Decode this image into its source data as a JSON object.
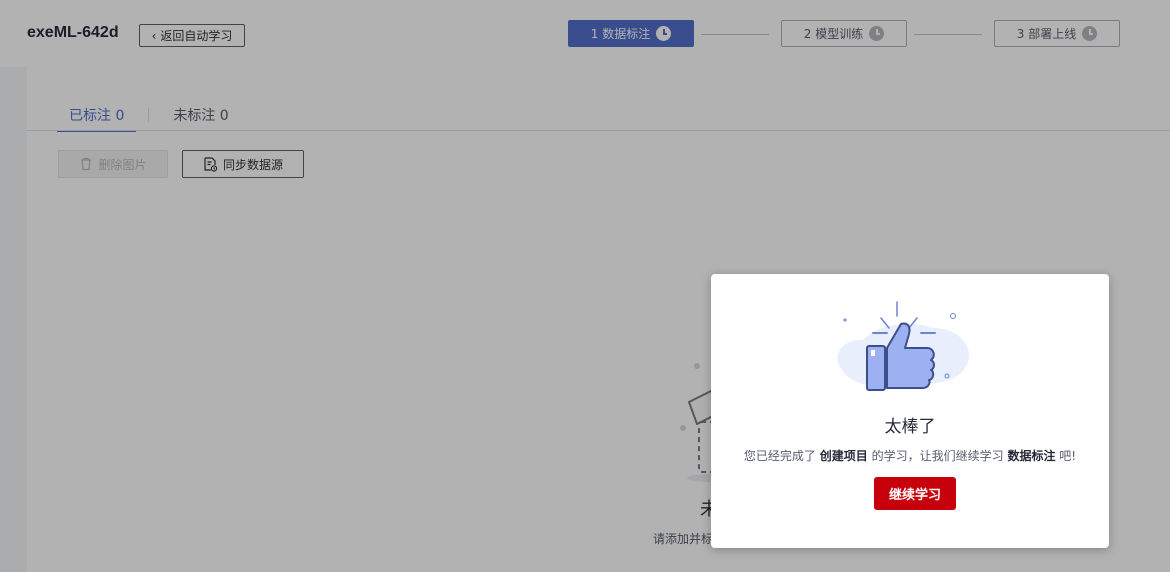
{
  "header": {
    "project_title": "exeML-642d",
    "back_label": "返回自动学习",
    "steps": [
      {
        "label": "1 数据标注",
        "state": "active"
      },
      {
        "label": "2 模型训练",
        "state": "pending"
      },
      {
        "label": "3 部署上线",
        "state": "pending"
      }
    ]
  },
  "tabs": [
    {
      "label": "已标注 0",
      "active": true
    },
    {
      "label": "未标注 0",
      "active": false
    }
  ],
  "toolbar": {
    "delete_label": "删除图片",
    "sync_label": "同步数据源"
  },
  "empty_state": {
    "title": "未",
    "desc": "请添加并标"
  },
  "dialog": {
    "title": "太棒了",
    "msg_prefix": "您已经完成了",
    "msg_bold1": "创建项目",
    "msg_middle": "的学习，让我们继续学习",
    "msg_bold2": "数据标注",
    "msg_suffix": "吧!",
    "continue_label": "继续学习"
  },
  "colors": {
    "primary": "#526ecc",
    "danger": "#c7000b"
  }
}
